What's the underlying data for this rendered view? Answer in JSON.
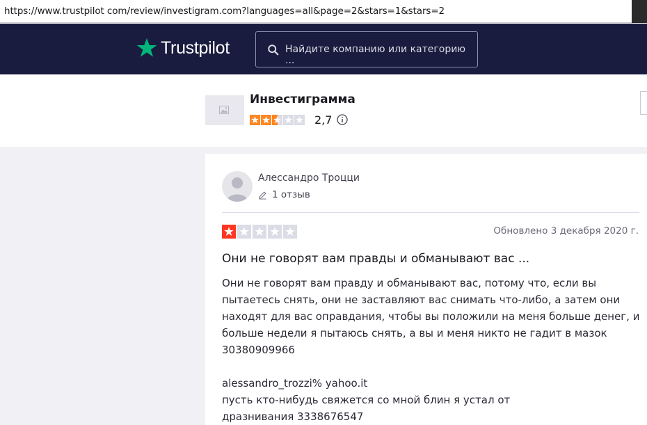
{
  "browser": {
    "url": "https://www.trustpilot com/review/investigram.com?languages=all&page=2&stars=1&stars=2"
  },
  "header": {
    "logo_text": "Trustpilot",
    "search_placeholder": "Найдите компанию или категорию ...",
    "brand_color": "#00b67a",
    "background_color": "#191c3e"
  },
  "company": {
    "name": "Инвестиграмма",
    "rating_text": "2,7",
    "rating_value": 2.5,
    "star_color": "#ff8622",
    "logo_icon": "image-placeholder-icon",
    "info_icon": "info-icon"
  },
  "review": {
    "reviewer_name": "Алессандро Троцци",
    "review_count": "1 отзыв",
    "stars": 1,
    "star_color": "#ff3722",
    "date": "Обновлено 3 декабря 2020 г.",
    "title": "Они не говорят вам правды и обманывают вас ...",
    "body": "Они не говорят вам правду и обманывают вас, потому что, если вы пытаетесь снять, они не заставляют вас снимать что-либо, а затем они находят для вас оправдания, чтобы вы положили на меня больше денег, и больше недели я пытаюсь снять, а вы и меня никто не гадит в мазок\n30380909966\n\nalessandro_trozzi% yahoo.it\nпусть кто-нибудь свяжется со мной блин я устал от\nдразнивания 3338676547"
  }
}
